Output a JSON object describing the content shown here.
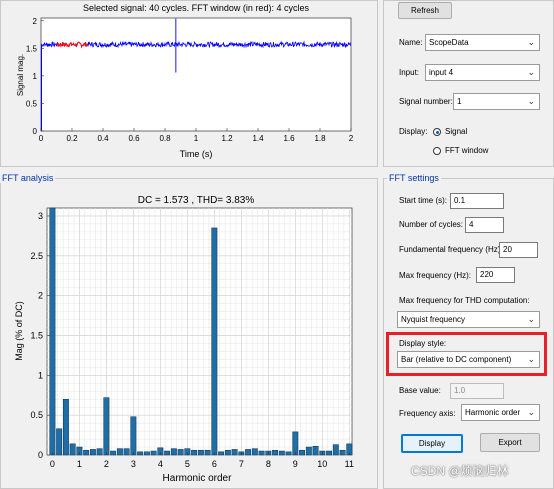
{
  "signal_plot": {
    "title": "Selected signal: 40 cycles. FFT window (in red): 4 cycles",
    "ylabel": "Signal mag.",
    "xlabel": "Time (s)",
    "yticks": [
      "0",
      "0.5",
      "1",
      "1.5",
      "2"
    ],
    "xticks": [
      "0",
      "0.2",
      "0.4",
      "0.6",
      "0.8",
      "1",
      "1.2",
      "1.4",
      "1.6",
      "1.8",
      "2"
    ]
  },
  "fft_analysis": {
    "group_label": "FFT analysis"
  },
  "fft_settings": {
    "group_label": "FFT settings"
  },
  "controls": {
    "refresh_label": "Refresh",
    "name_label": "Name:",
    "name_value": "ScopeData",
    "input_label": "Input:",
    "input_value": "input 4",
    "signal_number_label": "Signal number:",
    "signal_number_value": "1",
    "display_label": "Display:",
    "display_signal_label": "Signal",
    "display_fft_label": "FFT window",
    "start_time_label": "Start time (s):",
    "start_time_value": "0.1",
    "cycles_label": "Number of cycles:",
    "cycles_value": "4",
    "fundamental_label": "Fundamental frequency (Hz):",
    "fundamental_value": "20",
    "max_freq_label": "Max frequency (Hz):",
    "max_freq_value": "220",
    "max_freq_thd_label": "Max frequency for THD computation:",
    "max_freq_thd_value": "Nyquist frequency",
    "display_style_label": "Display style:",
    "display_style_value": "Bar (relative to DC component)",
    "base_value_label": "Base value:",
    "base_value_value": "1.0",
    "freq_axis_label": "Frequency axis:",
    "freq_axis_value": "Harmonic order",
    "display_button": "Display",
    "export_button": "Export"
  },
  "watermark": "CSDN @烦恼归林",
  "colors": {
    "signal_trace": "#0000ff",
    "fft_window_trace": "#ff0000",
    "bar_fill": "#1f6ea8",
    "highlight_box": "#e8202a"
  },
  "chart_data": {
    "type": "bar",
    "title": "DC = 1.573 , THD= 3.83%",
    "xlabel": "Harmonic order",
    "ylabel": "Mag (% of DC)",
    "xticks": [
      "0",
      "1",
      "2",
      "3",
      "4",
      "5",
      "6",
      "7",
      "8",
      "9",
      "10",
      "11"
    ],
    "yticks": [
      "0",
      "0.5",
      "1",
      "1.5",
      "2",
      "2.5",
      "3"
    ],
    "ylim": [
      0,
      3.1
    ],
    "xlim": [
      -0.2,
      11.1
    ],
    "grid": true,
    "x": [
      0,
      0.25,
      0.5,
      0.75,
      1,
      1.25,
      1.5,
      1.75,
      2,
      2.25,
      2.5,
      2.75,
      3,
      3.25,
      3.5,
      3.75,
      4,
      4.25,
      4.5,
      4.75,
      5,
      5.25,
      5.5,
      5.75,
      6,
      6.25,
      6.5,
      6.75,
      7,
      7.25,
      7.5,
      7.75,
      8,
      8.25,
      8.5,
      8.75,
      9,
      9.25,
      9.5,
      9.75,
      10,
      10.25,
      10.5,
      10.75,
      11
    ],
    "values": [
      3.1,
      0.33,
      0.7,
      0.14,
      0.1,
      0.06,
      0.07,
      0.08,
      0.72,
      0.05,
      0.08,
      0.08,
      0.48,
      0.04,
      0.04,
      0.05,
      0.09,
      0.05,
      0.08,
      0.07,
      0.08,
      0.06,
      0.06,
      0.06,
      2.85,
      0.04,
      0.06,
      0.07,
      0.04,
      0.07,
      0.08,
      0.05,
      0.05,
      0.06,
      0.05,
      0.04,
      0.29,
      0.06,
      0.1,
      0.11,
      0.05,
      0.05,
      0.13,
      0.06,
      0.14
    ]
  }
}
